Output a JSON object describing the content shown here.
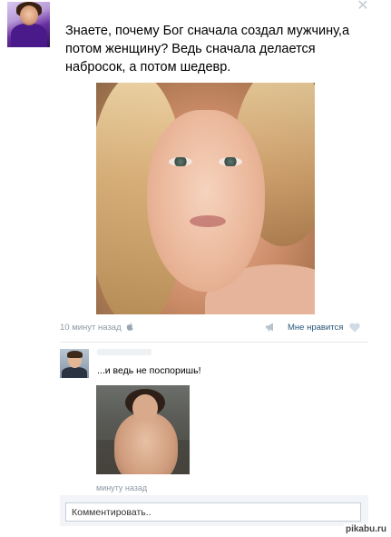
{
  "post": {
    "text": "Знаете, почему Бог сначала создал мужчину,а потом женщину? Ведь сначала делается набросок, а потом шедевр.",
    "time": "10 минут назад",
    "like_label": "Мне нравится",
    "icons": {
      "close": "close-icon",
      "device": "apple-icon",
      "share": "megaphone-icon",
      "like": "heart-icon"
    }
  },
  "comment": {
    "text": "...и ведь не поспоришь!",
    "time": "минуту назад"
  },
  "reply": {
    "placeholder": "Комментировать.."
  },
  "watermark": "pikabu.ru",
  "colors": {
    "link": "#2b587a",
    "meta": "#8e99a5",
    "divider": "#e4e8ed",
    "input_border": "#c5d0da"
  }
}
